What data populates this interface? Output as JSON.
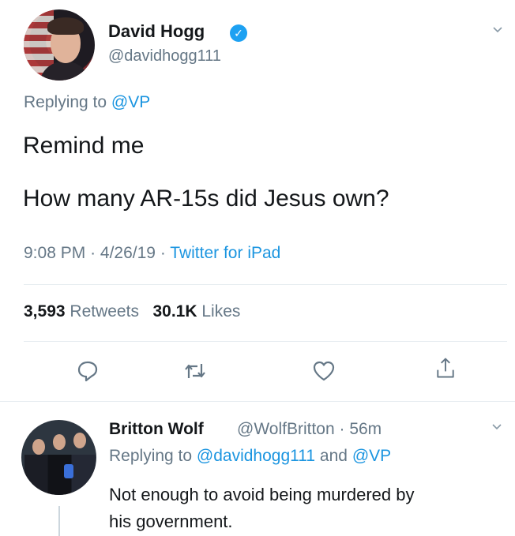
{
  "main_tweet": {
    "author_name": "David Hogg",
    "verified_icon": "check",
    "author_handle": "@davidhogg111",
    "replying_prefix": "Replying to",
    "replying_to": "@VP",
    "text_lines": [
      "Remind me",
      "How many AR-15s did Jesus own?"
    ],
    "time": "9:08 PM",
    "date": "4/26/19",
    "source": "Twitter for iPad",
    "separator": "·",
    "retweets_count": "3,593",
    "retweets_label": "Retweets",
    "likes_count": "30.1K",
    "likes_label": "Likes"
  },
  "reply_tweet": {
    "author_name": "Britton Wolf",
    "author_handle": "@WolfBritton",
    "time_ago": "56m",
    "replying_prefix": "Replying to",
    "replying_user_1": "@davidhogg111",
    "replying_and": "and",
    "replying_user_2": "@VP",
    "text_lines": [
      "Not enough to avoid being murdered by",
      "his government."
    ]
  },
  "icons": {
    "reply": "reply-icon",
    "retweet": "retweet-icon",
    "like": "heart-icon",
    "share": "share-icon",
    "menu": "chevron-down-icon"
  },
  "colors": {
    "text": "#14171a",
    "muted": "#657786",
    "link": "#1b95e0",
    "verified": "#1da1f2",
    "divider": "#e6ecf0"
  }
}
